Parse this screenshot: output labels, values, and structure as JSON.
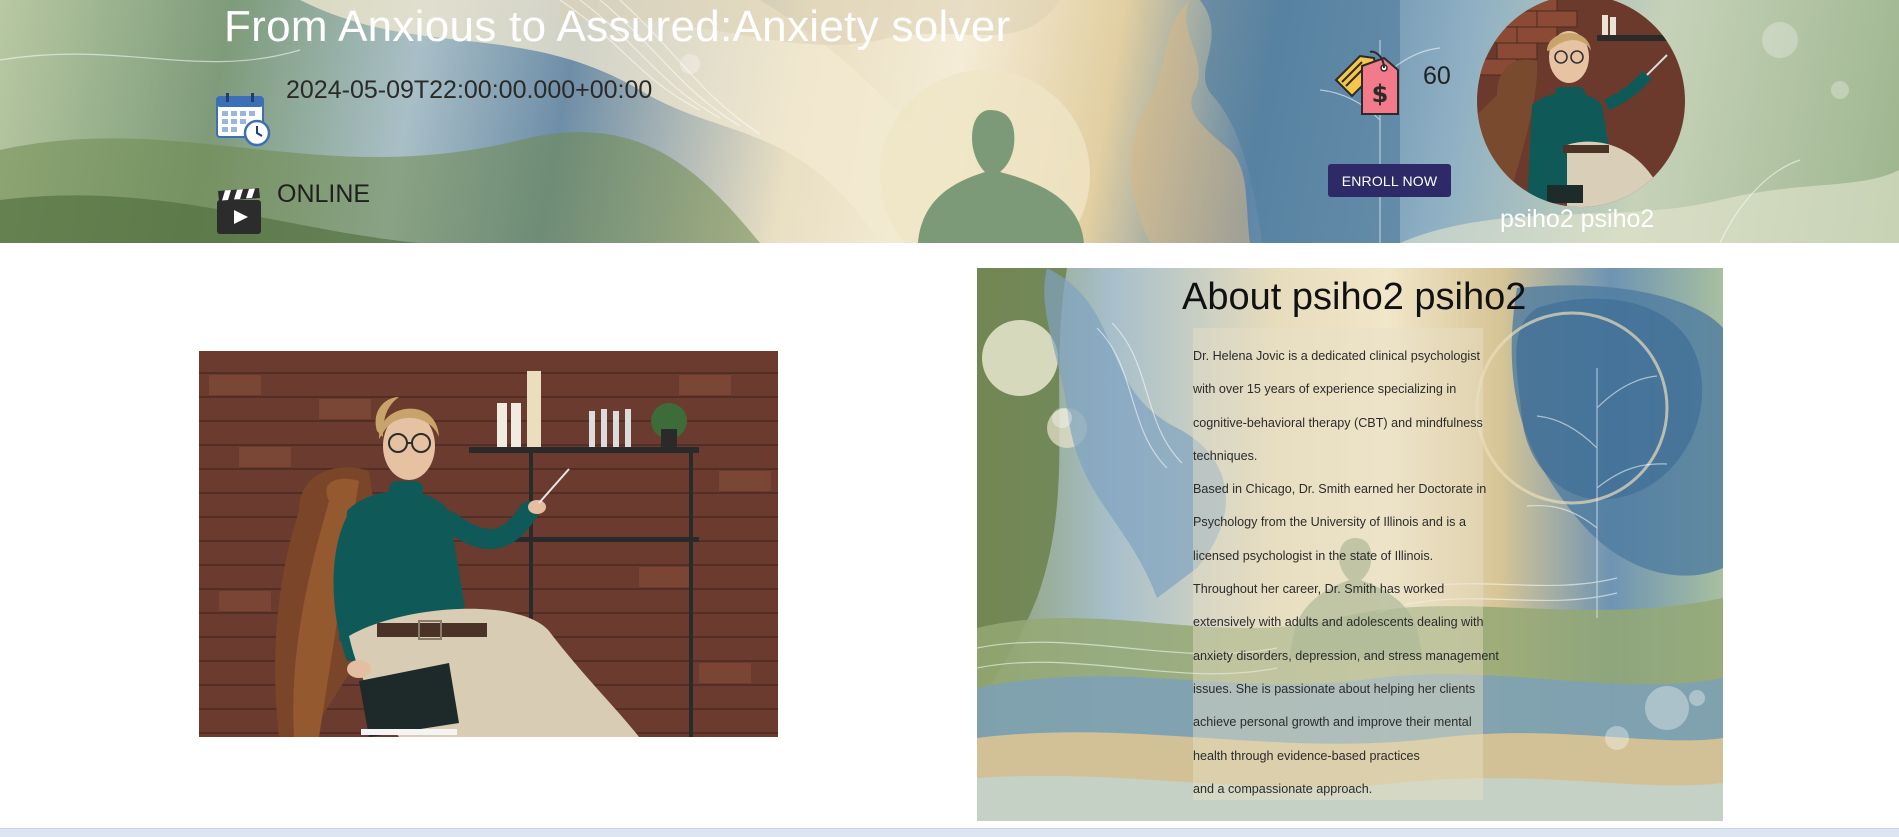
{
  "event": {
    "title": "From Anxious to Assured:Anxiety solver",
    "datetime": "2024-05-09T22:00:00.000+00:00",
    "mode": "ONLINE",
    "price": "60",
    "enroll_label": "ENROLL NOW",
    "host_name": "psiho2 psiho2"
  },
  "icons": {
    "calendar": "calendar-clock-icon",
    "mode": "clapperboard-play-icon",
    "price": "price-tags-dollar-icon"
  },
  "about": {
    "title": "About psiho2 psiho2",
    "lines": [
      "Dr. Helena Jovic is a dedicated clinical psychologist",
      "with over 15 years of experience specializing in",
      "cognitive-behavioral therapy (CBT) and mindfulness",
      "techniques.",
      "Based in Chicago, Dr. Smith earned her Doctorate in",
      "Psychology from the University of Illinois and is a",
      "licensed psychologist in the state of Illinois.",
      "Throughout her career, Dr. Smith has worked",
      "extensively with adults and adolescents dealing with",
      "anxiety disorders, depression, and stress management",
      "issues. She is passionate about helping her clients",
      "achieve personal growth and improve their mental",
      "health through evidence-based practices",
      "and a compassionate approach."
    ]
  },
  "colors": {
    "enroll_button": "#2e2967",
    "title_text": "#ffffff",
    "price_tag_pink": "#f37a8a",
    "price_tag_yellow": "#f6c64a",
    "sweater_teal": "#0f5a58"
  }
}
